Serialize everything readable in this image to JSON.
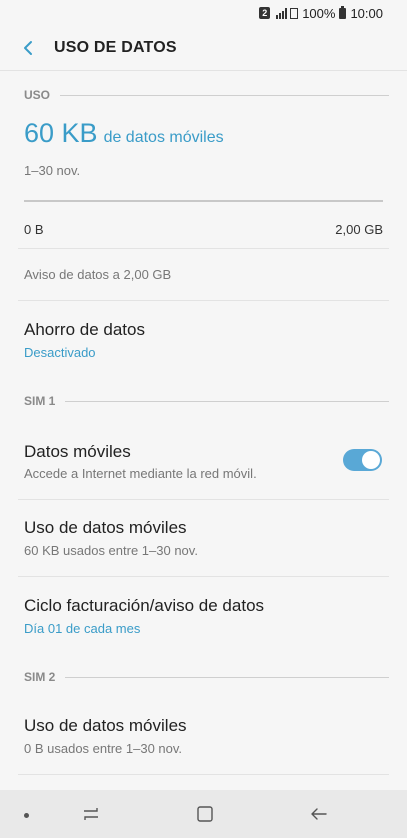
{
  "status_bar": {
    "sim_badge": "2",
    "battery": "100%",
    "time": "10:00"
  },
  "header": {
    "title": "USO DE DATOS",
    "back_icon": "back-arrow-icon"
  },
  "usage": {
    "section_label": "USO",
    "amount": "60 KB",
    "amount_suffix": "de datos móviles",
    "period": "1–30 nov.",
    "progress_fraction": 0.0,
    "range_min": "0 B",
    "range_max": "2,00 GB",
    "warning": "Aviso de datos a 2,00 GB"
  },
  "data_saver": {
    "title": "Ahorro de datos",
    "status": "Desactivado"
  },
  "sim1": {
    "section_label": "SIM 1",
    "mobile_data": {
      "title": "Datos móviles",
      "subtitle": "Accede a Internet mediante la red móvil.",
      "enabled": true
    },
    "usage": {
      "title": "Uso de datos móviles",
      "subtitle": "60 KB usados entre 1–30 nov."
    },
    "billing": {
      "title": "Ciclo facturación/aviso de datos",
      "subtitle": "Día 01 de cada mes"
    }
  },
  "sim2": {
    "section_label": "SIM 2",
    "usage": {
      "title": "Uso de datos móviles",
      "subtitle": "0 B usados entre 1–30 nov."
    }
  },
  "navbar": {
    "items": [
      "recents-icon",
      "home-icon",
      "back-icon"
    ]
  },
  "colors": {
    "accent": "#3a9cc8",
    "toggle_on": "#59a8d6",
    "background": "#f6f6f6",
    "navbar": "#e9e9e9"
  }
}
